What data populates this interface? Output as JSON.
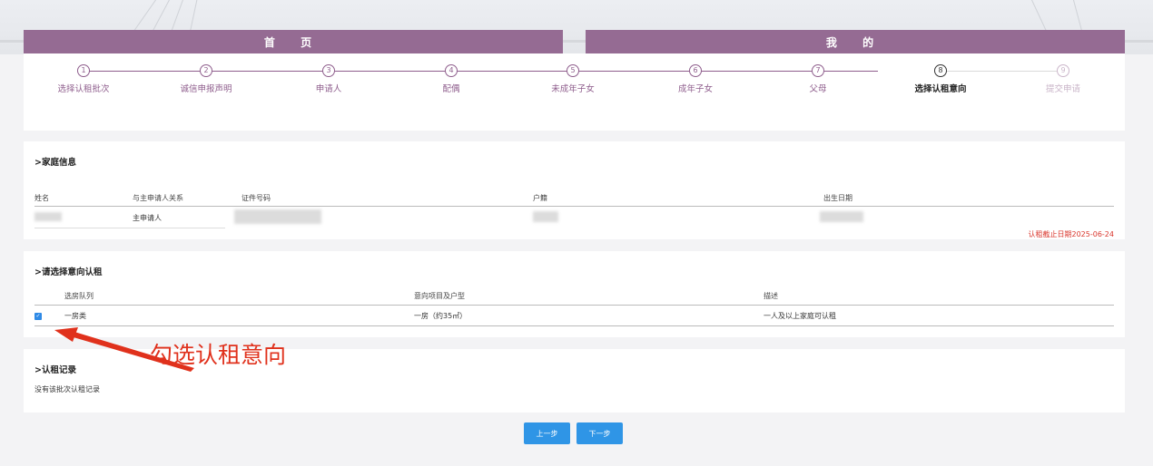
{
  "nav": {
    "home_label": "首 页",
    "mine_label": "我 的"
  },
  "steps": [
    {
      "num": "1",
      "label": "选择认租批次",
      "state": "done"
    },
    {
      "num": "2",
      "label": "诚信申报声明",
      "state": "done"
    },
    {
      "num": "3",
      "label": "申请人",
      "state": "done"
    },
    {
      "num": "4",
      "label": "配偶",
      "state": "done"
    },
    {
      "num": "5",
      "label": "未成年子女",
      "state": "done"
    },
    {
      "num": "6",
      "label": "成年子女",
      "state": "done"
    },
    {
      "num": "7",
      "label": "父母",
      "state": "done"
    },
    {
      "num": "8",
      "label": "选择认租意向",
      "state": "current"
    },
    {
      "num": "9",
      "label": "提交申请",
      "state": "todo"
    }
  ],
  "family": {
    "title": ">家庭信息",
    "headers": {
      "name": "姓名",
      "relation": "与主申请人关系",
      "id_no": "证件号码",
      "huji": "户籍",
      "birth": "出生日期"
    },
    "row": {
      "relation": "主申请人"
    },
    "deadline": "认租截止日期2025-06-24"
  },
  "intent": {
    "title": ">请选择意向认租",
    "headers": {
      "queue": "选房队列",
      "project": "意向项目及户型",
      "desc": "描述"
    },
    "row": {
      "checked": true,
      "queue": "一房类",
      "project": "一房（约35㎡）",
      "desc": "一人及以上家庭可认租"
    }
  },
  "record": {
    "title": ">认租记录",
    "empty_text": "没有该批次认租记录"
  },
  "buttons": {
    "prev": "上一步",
    "next": "下一步"
  },
  "annotation": {
    "text": "勾选认租意向",
    "color": "#e0311c"
  },
  "colors": {
    "nav": "#956b93",
    "step_done": "#8e5d8c",
    "button": "#2f95e6",
    "deadline": "#d9342b"
  }
}
